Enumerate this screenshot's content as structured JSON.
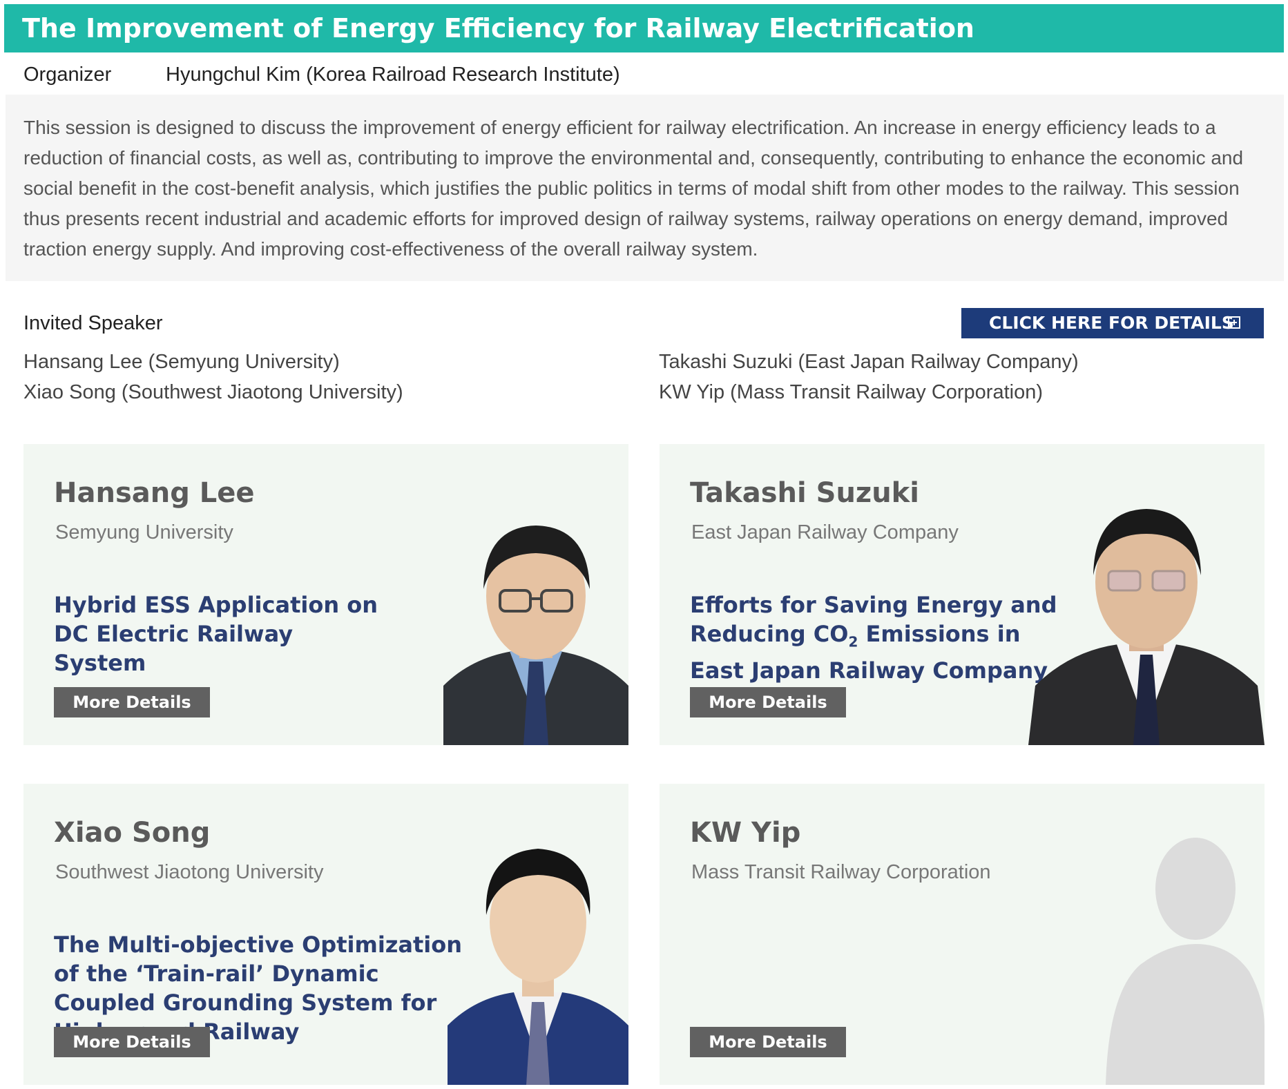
{
  "header": {
    "title": "The Improvement of Energy Efficiency for Railway Electrification"
  },
  "organizer": {
    "label": "Organizer",
    "value": "Hyungchul Kim (Korea Railroad Research Institute)"
  },
  "description": "This session is designed to discuss the improvement of energy efficient for railway electrification. An increase in energy efficiency leads to a reduction of financial costs, as well as, contributing to improve the environmental and, consequently, contributing to enhance the economic and social benefit in the cost-benefit analysis, which justifies the public politics in terms of modal shift from other modes to the railway. This session thus presents recent industrial and academic efforts for improved design of railway systems, railway operations on energy demand, improved traction energy supply. And improving cost-effectiveness of the overall railway system.",
  "invited": {
    "label": "Invited Speaker",
    "details_button": "CLICK HERE FOR DETAILS",
    "speakers_left": [
      "Hansang Lee (Semyung University)",
      "Xiao Song (Southwest Jiaotong University)"
    ],
    "speakers_right": [
      "Takashi Suzuki (East Japan Railway Company)",
      "KW Yip (Mass Transit Railway Corporation)"
    ]
  },
  "cards": [
    {
      "name": "Hansang Lee",
      "affiliation": "Semyung University",
      "talk": "Hybrid ESS Application on DC Electric Railway System",
      "button": "More Details"
    },
    {
      "name": "Takashi Suzuki",
      "affiliation": "East Japan Railway Company",
      "talk_line1": "Efforts for Saving Energy and",
      "talk_line2a": "Reducing CO",
      "talk_line2_sub": "2",
      "talk_line2b": " Emissions in",
      "talk_line3": "East Japan Railway Company",
      "button": "More Details"
    },
    {
      "name": "Xiao Song",
      "affiliation": "Southwest Jiaotong University",
      "talk": "The Multi-objective Optimization of the ‘Train-rail’ Dynamic Coupled Grounding System for High-speed Railway",
      "button": "More Details"
    },
    {
      "name": "KW Yip",
      "affiliation": "Mass Transit Railway Corporation",
      "button": "More Details"
    }
  ],
  "colors": {
    "header_bg": "#1fb9a8",
    "details_button_bg": "#1d3b7a",
    "card_bg": "#f2f7f2",
    "talk_title": "#2b3e72",
    "more_button_bg": "#616161"
  }
}
